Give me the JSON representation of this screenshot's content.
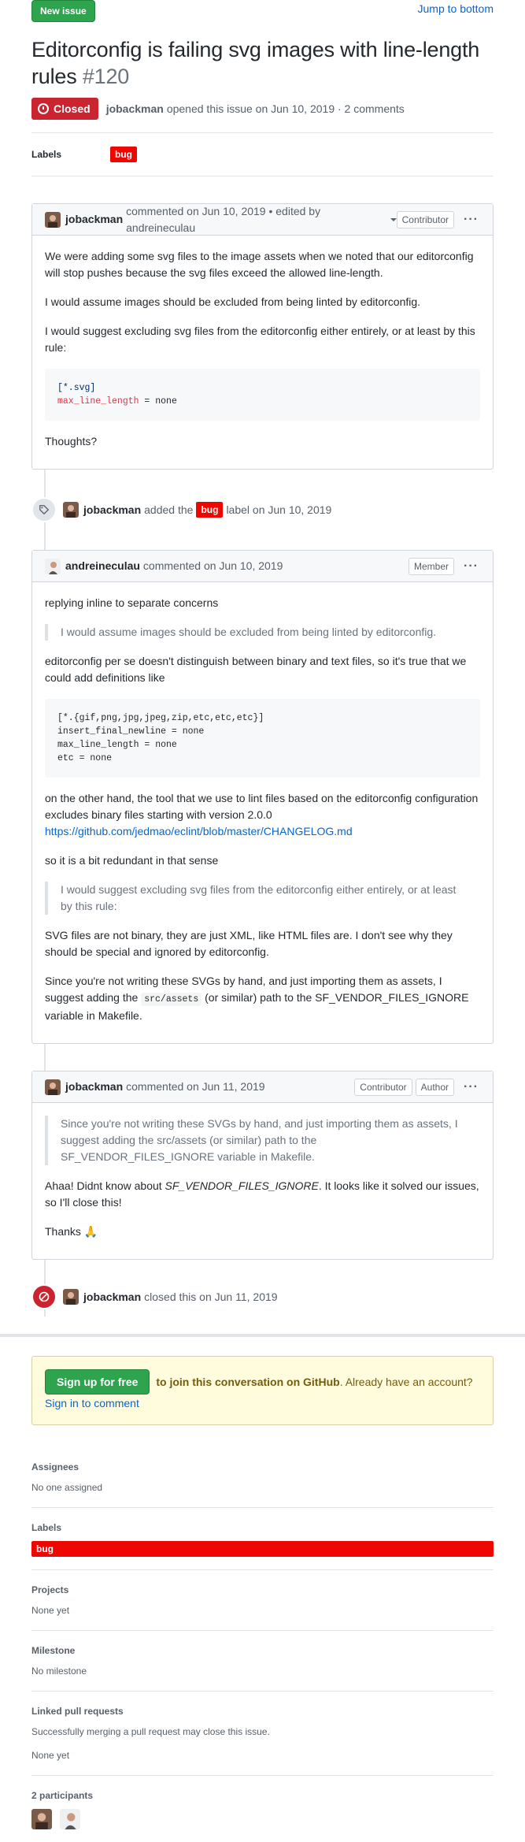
{
  "header": {
    "new_issue": "New issue",
    "jump": "Jump to bottom"
  },
  "issue": {
    "title": "Editorconfig is failing svg images with line-length rules",
    "number": "#120",
    "state": "Closed",
    "author": "jobackman",
    "opened_text": "opened this issue on Jun 10, 2019 · 2 comments",
    "labels_heading": "Labels",
    "label": "bug"
  },
  "comment1": {
    "author": "jobackman",
    "meta": "commented on Jun 10, 2019 • edited by andreineculau",
    "role": "Contributor",
    "p1": "We were adding some svg files to the image assets when we noted that our editorconfig will stop pushes because the svg files exceed the allowed line-length.",
    "p2": "I would assume images should be excluded from being linted by editorconfig.",
    "p3": "I would suggest excluding svg files from the editorconfig either entirely, or at least by this rule:",
    "code_line1": "[*.svg]",
    "code_key": "max_line_length",
    "code_rest": " = none",
    "p4": "Thoughts?"
  },
  "event_label": {
    "author": "jobackman",
    "before": "added the",
    "label": "bug",
    "after": "label on Jun 10, 2019"
  },
  "comment2": {
    "author": "andreineculau",
    "meta": "commented on Jun 10, 2019",
    "role": "Member",
    "p1": "replying inline to separate concerns",
    "q1": "I would assume images should be excluded from being linted by editorconfig.",
    "p2": "editorconfig per se doesn't distinguish between binary and text files, so it's true that we could add definitions like",
    "code": "[*.{gif,png,jpg,jpeg,zip,etc,etc,etc}]\ninsert_final_newline = none\nmax_line_length = none\netc = none",
    "p3": "on the other hand, the tool that we use to lint files based on the editorconfig configuration excludes binary files starting with version 2.0.0",
    "link": "https://github.com/jedmao/eclint/blob/master/CHANGELOG.md",
    "p4": "so it is a bit redundant in that sense",
    "q2": "I would suggest excluding svg files from the editorconfig either entirely, or at least by this rule:",
    "p5": "SVG files are not binary, they are just XML, like HTML files are. I don't see why they should be special and ignored by editorconfig.",
    "p6a": "Since you're not writing these SVGs by hand, and just importing them as assets, I suggest adding the",
    "p6code": "src/assets",
    "p6b": "(or similar) path to the SF_VENDOR_FILES_IGNORE variable in Makefile."
  },
  "comment3": {
    "author": "jobackman",
    "meta": "commented on Jun 11, 2019",
    "role1": "Contributor",
    "role2": "Author",
    "q1": "Since you're not writing these SVGs by hand, and just importing them as assets, I suggest adding the src/assets (or similar) path to the SF_VENDOR_FILES_IGNORE variable in Makefile.",
    "p1a": "Ahaa! Didnt know about",
    "p1em": "SF_VENDOR_FILES_IGNORE",
    "p1b": ". It looks like it solved our issues, so I'll close this!",
    "p2": "Thanks",
    "emoji": "🙏"
  },
  "event_closed": {
    "author": "jobackman",
    "text": "closed this on Jun 11, 2019"
  },
  "signup": {
    "button": "Sign up for free",
    "bold": "to join this conversation on GitHub",
    "text": ". Already have an account?",
    "link": "Sign in to comment"
  },
  "sidebar": {
    "assignees_h": "Assignees",
    "assignees_v": "No one assigned",
    "labels_h": "Labels",
    "labels_v": "bug",
    "projects_h": "Projects",
    "projects_v": "None yet",
    "milestone_h": "Milestone",
    "milestone_v": "No milestone",
    "linked_h": "Linked pull requests",
    "linked_desc": "Successfully merging a pull request may close this issue.",
    "linked_v": "None yet",
    "participants_h": "2 participants"
  }
}
